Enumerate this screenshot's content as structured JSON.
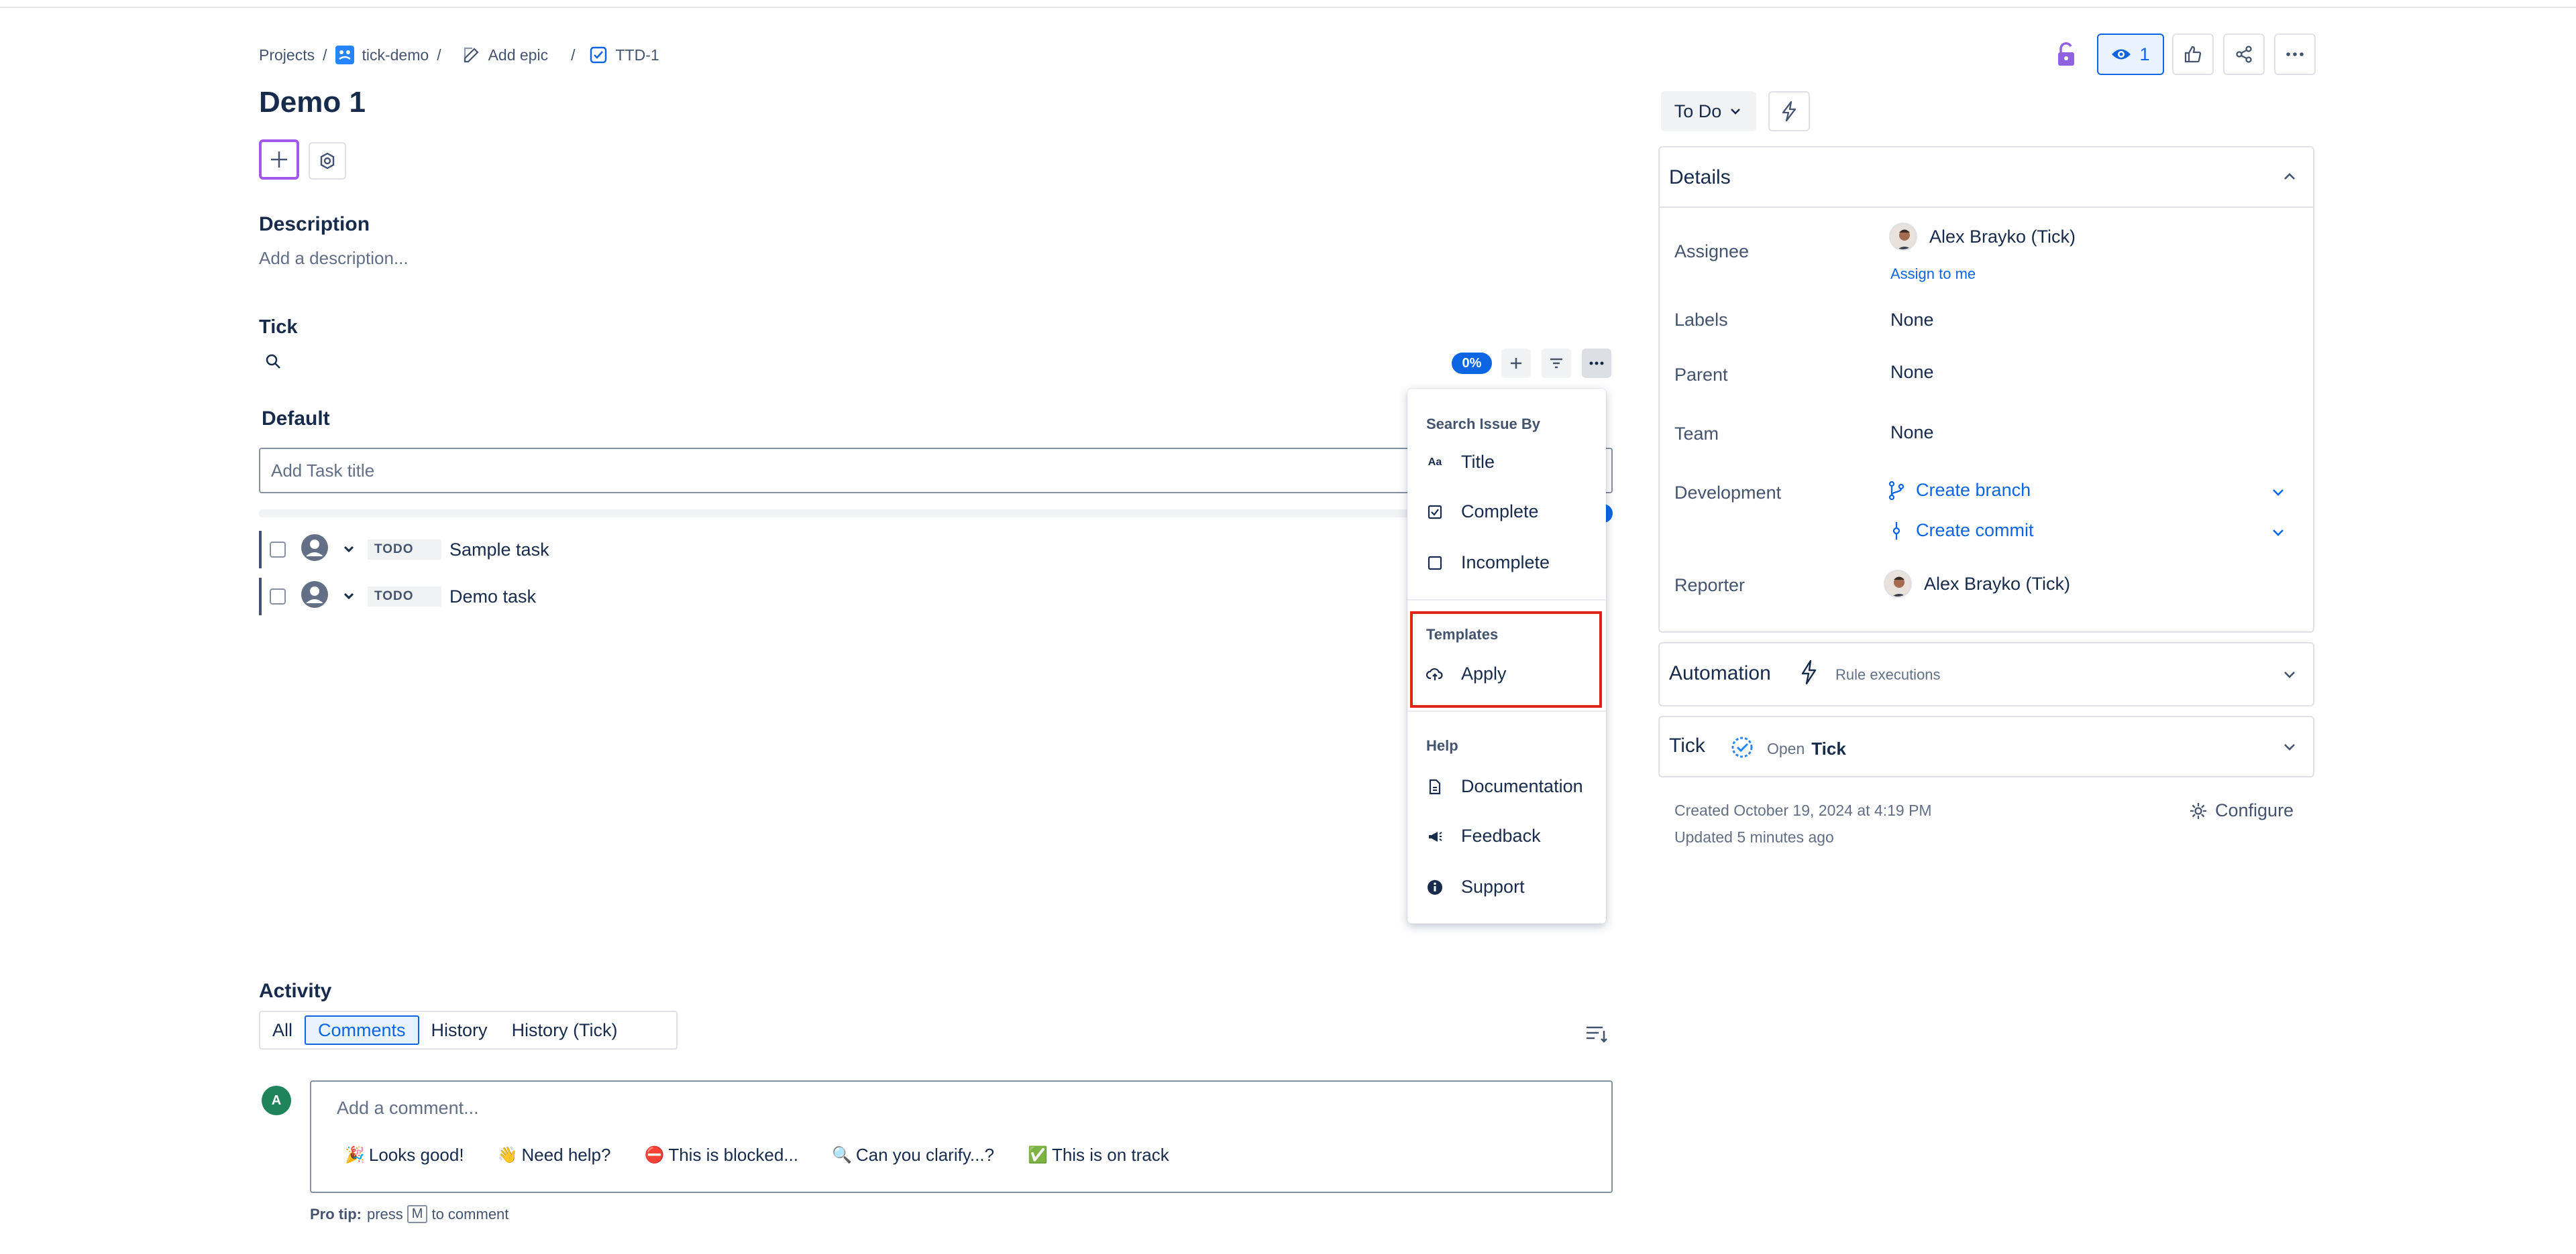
{
  "breadcrumb": {
    "projects": "Projects",
    "project": "tick-demo",
    "add_epic": "Add epic",
    "issue_key": "TTD-1"
  },
  "issue": {
    "title": "Demo 1",
    "description_heading": "Description",
    "description_placeholder": "Add a description..."
  },
  "tick": {
    "heading": "Tick",
    "progress": "0%",
    "group": "Default",
    "task_placeholder": "Add Task title",
    "tasks": [
      {
        "status": "TODO",
        "title": "Sample task"
      },
      {
        "status": "TODO",
        "title": "Demo task"
      }
    ]
  },
  "menu": {
    "search_section": "Search Issue By",
    "search_items": [
      "Title",
      "Complete",
      "Incomplete"
    ],
    "templates_section": "Templates",
    "templates_items": [
      "Apply"
    ],
    "help_section": "Help",
    "help_items": [
      "Documentation",
      "Feedback",
      "Support"
    ],
    "title_icon_text": "Aa"
  },
  "header_actions": {
    "watch_count": "1"
  },
  "status": {
    "label": "To Do"
  },
  "details": {
    "heading": "Details",
    "assignee_label": "Assignee",
    "assignee_value": "Alex Brayko (Tick)",
    "assign_to_me": "Assign to me",
    "labels_label": "Labels",
    "labels_value": "None",
    "parent_label": "Parent",
    "parent_value": "None",
    "team_label": "Team",
    "team_value": "None",
    "development_label": "Development",
    "create_branch": "Create branch",
    "create_commit": "Create commit",
    "reporter_label": "Reporter",
    "reporter_value": "Alex Brayko (Tick)"
  },
  "automation": {
    "heading": "Automation",
    "sub": "Rule executions"
  },
  "tick_panel": {
    "heading": "Tick",
    "open": "Open",
    "name": "Tick"
  },
  "meta": {
    "created": "Created October 19, 2024 at 4:19 PM",
    "updated": "Updated 5 minutes ago",
    "configure": "Configure"
  },
  "activity": {
    "heading": "Activity",
    "tabs": [
      "All",
      "Comments",
      "History",
      "History (Tick)"
    ],
    "active_tab": "Comments",
    "user_initial": "A",
    "comment_placeholder": "Add a comment...",
    "quick_replies": [
      {
        "emoji": "🎉",
        "text": "Looks good!"
      },
      {
        "emoji": "👋",
        "text": "Need help?"
      },
      {
        "emoji": "⛔",
        "text": "This is blocked..."
      },
      {
        "emoji": "🔍",
        "text": "Can you clarify...?"
      },
      {
        "emoji": "✅",
        "text": "This is on track"
      }
    ],
    "pro_tip_label": "Pro tip:",
    "pro_tip_press": "press",
    "pro_tip_key": "M",
    "pro_tip_rest": "to comment"
  },
  "colors": {
    "accent": "#0c66e4",
    "highlight_border": "#e0241a",
    "add_button_border": "#a259e8",
    "avatar_green": "#1f845a"
  }
}
